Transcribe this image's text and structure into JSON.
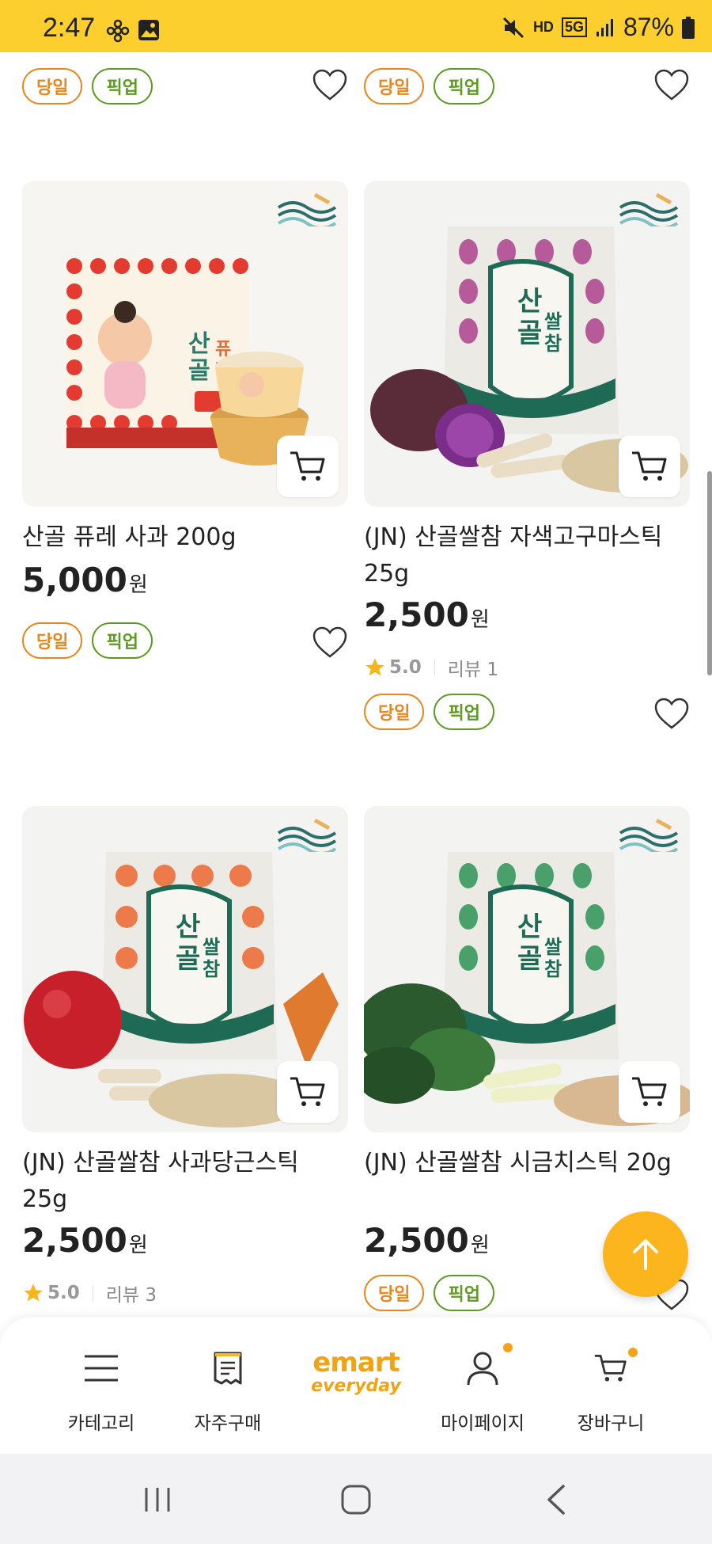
{
  "status_bar": {
    "time": "2:47",
    "battery": "87%",
    "network_hd": "HD",
    "network_5g": "5G"
  },
  "tags": {
    "same_day": "당일",
    "pickup": "픽업"
  },
  "currency": "원",
  "review_label_prefix": "리뷰",
  "products": [
    {
      "name": "산골 퓨레 사과 200g",
      "price": "5,000",
      "rating": null,
      "reviews": null
    },
    {
      "name": "(JN) 산골쌀참 자색고구마스틱 25g",
      "price": "2,500",
      "rating": "5.0",
      "reviews": "리뷰 1"
    },
    {
      "name": "(JN) 산골쌀참 사과당근스틱 25g",
      "price": "2,500",
      "rating": "5.0",
      "reviews": "리뷰 3"
    },
    {
      "name": "(JN) 산골쌀참 시금치스틱 20g",
      "price": "2,500",
      "rating": null,
      "reviews": null
    }
  ],
  "bottom_nav": {
    "items": [
      {
        "label": "카테고리",
        "icon": "menu-icon"
      },
      {
        "label": "자주구매",
        "icon": "receipt-icon"
      },
      {
        "label": "emart everyday",
        "icon": "emart-everyday-logo"
      },
      {
        "label": "마이페이지",
        "icon": "person-icon"
      },
      {
        "label": "장바구니",
        "icon": "cart-icon"
      }
    ],
    "logo_top": "emart",
    "logo_bottom": "everyday"
  },
  "colors": {
    "status_bar": "#fcce2e",
    "tag_orange": "#e8871f",
    "tag_green": "#5f9a24",
    "top_button": "#fcb51c",
    "star": "#f9b51c"
  }
}
